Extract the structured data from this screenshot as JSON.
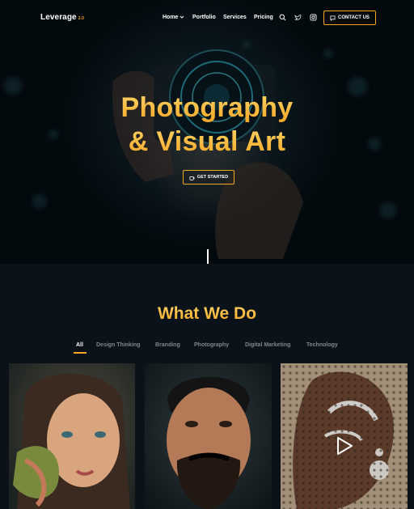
{
  "logo": {
    "name": "Leverage",
    "version": "2.0"
  },
  "nav": {
    "items": [
      "Home",
      "Portfolio",
      "Services",
      "Pricing"
    ],
    "contact_label": "CONTACT US"
  },
  "hero": {
    "title_line1": "Photography",
    "title_line2": "& Visual Art",
    "cta_label": "GET STARTED"
  },
  "section": {
    "title": "What We Do",
    "filters": [
      "All",
      "Design Thinking",
      "Branding",
      "Photography",
      "Digital Marketing",
      "Technology"
    ],
    "active_filter": "All"
  },
  "colors": {
    "accent": "#f5a623",
    "background": "#0b1219",
    "muted": "#7d8790"
  },
  "icons": [
    "chevron-down-icon",
    "search-icon",
    "twitter-icon",
    "instagram-icon",
    "chat-icon",
    "coffee-icon",
    "play-icon"
  ]
}
